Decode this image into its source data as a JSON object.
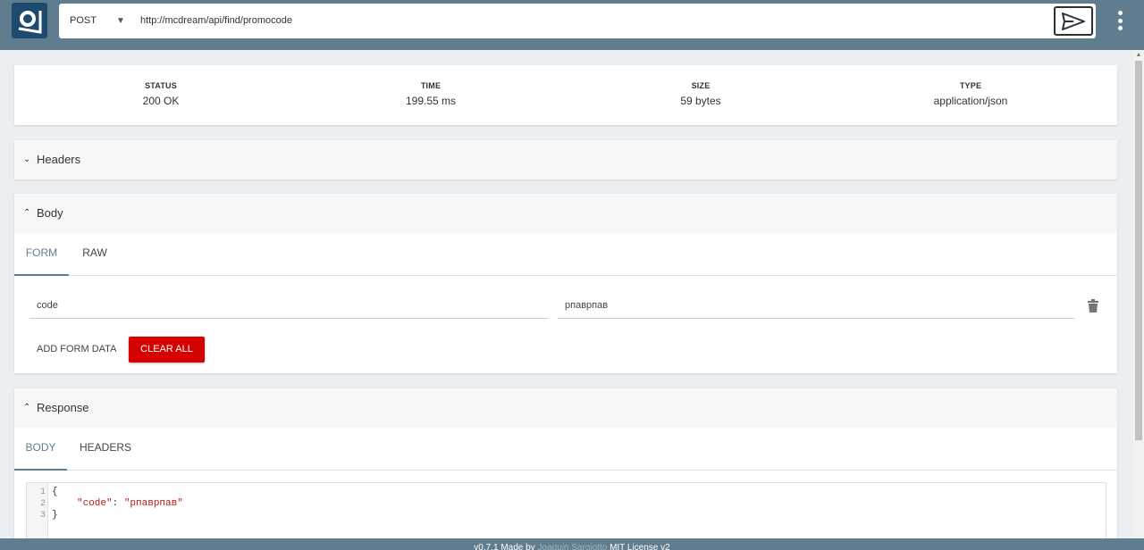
{
  "request": {
    "method": "POST",
    "url": "http://mcdream/api/find/promocode"
  },
  "icons": {
    "logo": "app-logo-icon",
    "send": "send-icon",
    "menu": "more-vertical-icon",
    "trash": "trash-icon"
  },
  "colors": {
    "topbar": "#5f7d8e",
    "accent": "#5f7d8e",
    "danger": "#d50000",
    "logo": "#1e4a6e"
  },
  "stats": [
    {
      "label": "STATUS",
      "value": "200 OK"
    },
    {
      "label": "TIME",
      "value": "199.55 ms"
    },
    {
      "label": "SIZE",
      "value": "59 bytes"
    },
    {
      "label": "TYPE",
      "value": "application/json"
    }
  ],
  "headers_panel": {
    "title": "Headers"
  },
  "body_panel": {
    "title": "Body",
    "tabs": [
      "FORM",
      "RAW"
    ],
    "active_tab": "FORM",
    "form_rows": [
      {
        "key": "code",
        "value": "рпаврпав"
      }
    ],
    "add_label": "ADD FORM DATA",
    "clear_label": "CLEAR ALL"
  },
  "response_panel": {
    "title": "Response",
    "tabs": [
      "BODY",
      "HEADERS"
    ],
    "active_tab": "BODY",
    "lines": [
      {
        "num": "1",
        "text": "{"
      },
      {
        "num": "2",
        "key": "\"code\"",
        "sep": ": ",
        "val": "\"рпаврпав\""
      },
      {
        "num": "3",
        "text": "}"
      }
    ]
  },
  "footer": {
    "version": "v0.7.1",
    "made_by": "Made by",
    "author": "Joaquin Sargiotto",
    "license": "MIT License v2"
  }
}
